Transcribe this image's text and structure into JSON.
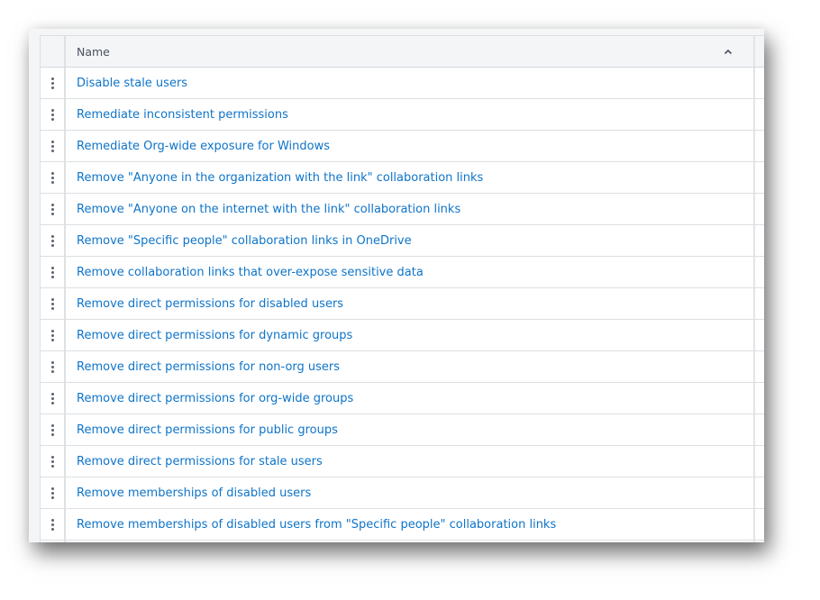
{
  "table": {
    "columns": [
      {
        "label": "Name",
        "sort": "ascending",
        "sort_icon": "chevron-up-icon"
      }
    ],
    "row_menu_icon": "kebab-menu-icon",
    "rows": [
      {
        "name": "Disable stale users"
      },
      {
        "name": "Remediate inconsistent permissions"
      },
      {
        "name": "Remediate Org-wide exposure for Windows"
      },
      {
        "name": "Remove \"Anyone in the organization with the link\" collaboration links"
      },
      {
        "name": "Remove \"Anyone on the internet with the link\" collaboration links"
      },
      {
        "name": "Remove \"Specific people\" collaboration links in OneDrive"
      },
      {
        "name": "Remove collaboration links that over-expose sensitive data"
      },
      {
        "name": "Remove direct permissions for disabled users"
      },
      {
        "name": "Remove direct permissions for dynamic groups"
      },
      {
        "name": "Remove direct permissions for non-org users"
      },
      {
        "name": "Remove direct permissions for org-wide groups"
      },
      {
        "name": "Remove direct permissions for public groups"
      },
      {
        "name": "Remove direct permissions for stale users"
      },
      {
        "name": "Remove memberships of disabled users"
      },
      {
        "name": "Remove memberships of disabled users from \"Specific people\" collaboration links"
      }
    ]
  },
  "colors": {
    "link": "#0e74c9",
    "header_bg": "#f4f5f7",
    "border": "#dcdfe3",
    "header_text": "#4a5260"
  }
}
